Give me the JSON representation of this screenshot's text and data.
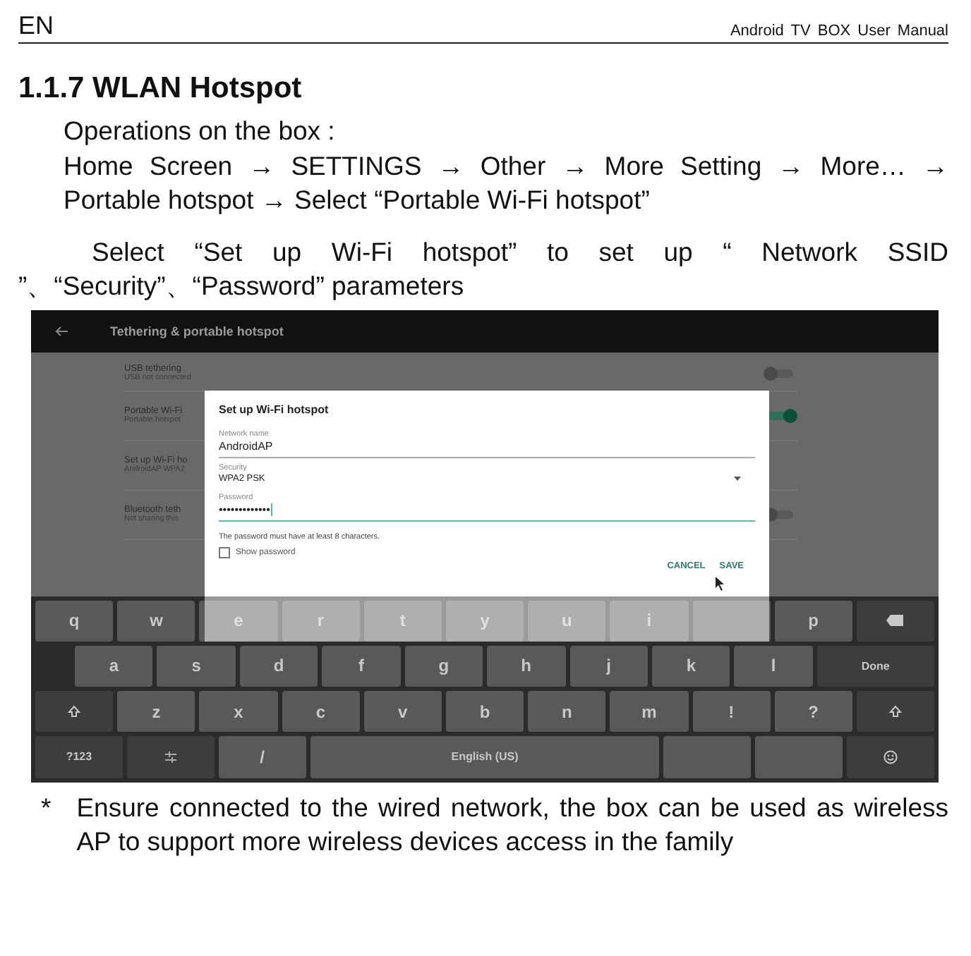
{
  "header": {
    "language": "EN",
    "title": "Android TV BOX User Manual"
  },
  "heading": "1.1.7 WLAN Hotspot",
  "steps": {
    "intro": "Operations on the box :",
    "path": "Home Screen → SETTINGS → Other → More Setting → More… → Portable hotspot → Select “Portable Wi-Fi hotspot”"
  },
  "instruction": "Select “Set up Wi-Fi hotspot” to set up “ Network SSID ”、“Security”、“Password” parameters",
  "screenshot": {
    "app_bar": {
      "title": "Tethering & portable hotspot"
    },
    "settings": [
      {
        "title": "USB tethering",
        "subtitle": "USB not connected",
        "switch_on": false
      },
      {
        "title": "Portable Wi-Fi",
        "subtitle": "Portable hotspot",
        "switch_on": true
      },
      {
        "title": "Set up Wi-Fi ho",
        "subtitle": "AndroidAP WPA2"
      },
      {
        "title": "Bluetooth teth",
        "subtitle": "Not sharing this",
        "switch_on": false
      }
    ],
    "dialog": {
      "title": "Set up Wi-Fi hotspot",
      "fields": [
        {
          "kind": "text",
          "label": "Network name",
          "value": "AndroidAP",
          "focused": false
        },
        {
          "kind": "select",
          "label": "Security",
          "value": "WPA2 PSK",
          "focused": false
        },
        {
          "kind": "password",
          "label": "Password",
          "value": "•••••••••••••",
          "focused": true
        }
      ],
      "helper": "The password must have at least 8 characters.",
      "checkbox": {
        "label": "Show password",
        "checked": false
      },
      "actions": [
        "CANCEL",
        "SAVE"
      ]
    },
    "keyboard": {
      "rows": [
        {
          "keys": [
            {
              "kind": "char",
              "label": "q"
            },
            {
              "kind": "char",
              "label": "w"
            },
            {
              "kind": "char",
              "label": "e"
            },
            {
              "kind": "char",
              "label": "r"
            },
            {
              "kind": "char",
              "label": "t"
            },
            {
              "kind": "char",
              "label": "y"
            },
            {
              "kind": "char",
              "label": "u"
            },
            {
              "kind": "char",
              "label": "i"
            },
            {
              "kind": "blank"
            },
            {
              "kind": "char",
              "label": "p"
            },
            {
              "kind": "backspace"
            }
          ]
        },
        {
          "keys": [
            {
              "kind": "char",
              "label": "a"
            },
            {
              "kind": "char",
              "label": "s"
            },
            {
              "kind": "char",
              "label": "d"
            },
            {
              "kind": "char",
              "label": "f"
            },
            {
              "kind": "char",
              "label": "g"
            },
            {
              "kind": "char",
              "label": "h"
            },
            {
              "kind": "char",
              "label": "j"
            },
            {
              "kind": "char",
              "label": "k"
            },
            {
              "kind": "char",
              "label": "l"
            },
            {
              "kind": "enter",
              "label": "Done"
            }
          ]
        },
        {
          "keys": [
            {
              "kind": "shift"
            },
            {
              "kind": "char",
              "label": "z"
            },
            {
              "kind": "char",
              "label": "x"
            },
            {
              "kind": "char",
              "label": "c"
            },
            {
              "kind": "char",
              "label": "v"
            },
            {
              "kind": "char",
              "label": "b"
            },
            {
              "kind": "char",
              "label": "n"
            },
            {
              "kind": "char",
              "label": "m"
            },
            {
              "kind": "char",
              "label": "!"
            },
            {
              "kind": "char",
              "label": "?"
            },
            {
              "kind": "shift"
            }
          ]
        },
        {
          "keys": [
            {
              "kind": "symbols",
              "label": "?123"
            },
            {
              "kind": "settings"
            },
            {
              "kind": "char",
              "label": "/"
            },
            {
              "kind": "space",
              "label": "English (US)"
            },
            {
              "kind": "blank"
            },
            {
              "kind": "blank"
            },
            {
              "kind": "emoji"
            }
          ]
        }
      ]
    }
  },
  "note": {
    "mark": "*",
    "text": "Ensure connected to the wired network, the box can be used as wireless AP to support more wireless devices access in the family"
  }
}
